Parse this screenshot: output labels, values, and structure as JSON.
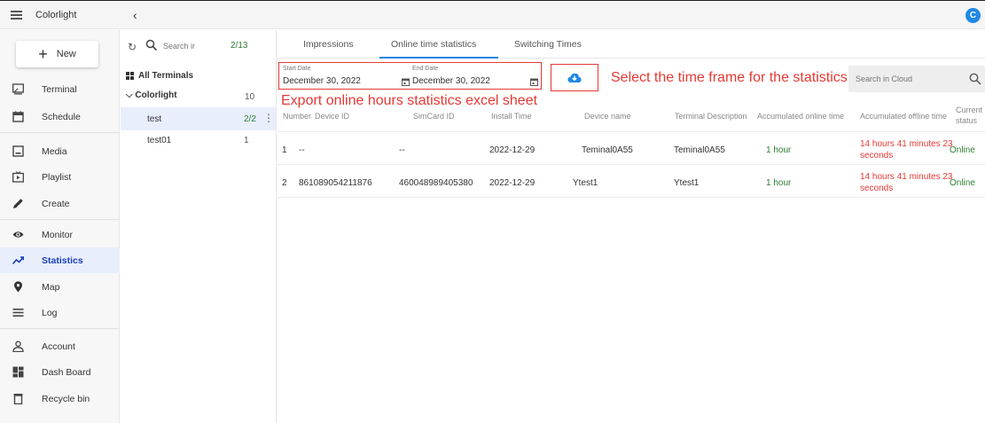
{
  "app": {
    "title": "Colorlight",
    "avatar_letter": "C",
    "collapse_glyph": "‹"
  },
  "nav": {
    "new_label": "New",
    "items": [
      {
        "label": "Terminal",
        "icon": "terminal-icon"
      },
      {
        "label": "Schedule",
        "icon": "schedule-icon"
      },
      {
        "label": "Media",
        "icon": "media-icon"
      },
      {
        "label": "Playlist",
        "icon": "playlist-icon"
      },
      {
        "label": "Create",
        "icon": "create-icon"
      },
      {
        "label": "Monitor",
        "icon": "eye-icon"
      },
      {
        "label": "Statistics",
        "icon": "statistics-icon",
        "active": true
      },
      {
        "label": "Map",
        "icon": "map-pin-icon"
      },
      {
        "label": "Log",
        "icon": "log-icon"
      },
      {
        "label": "Account",
        "icon": "account-icon"
      },
      {
        "label": "Dash Board",
        "icon": "dashboard-icon"
      },
      {
        "label": "Recycle bin",
        "icon": "recycle-bin-icon"
      }
    ]
  },
  "terminals": {
    "search_placeholder": "Search ir",
    "count": "2/13",
    "all_label": "All Terminals",
    "group": {
      "name": "Colorlight",
      "count": "10"
    },
    "rows": [
      {
        "name": "test",
        "count": "2/2"
      },
      {
        "name": "test01",
        "count": "1"
      }
    ]
  },
  "tabs": [
    "Impressions",
    "Online time statistics",
    "Switching Times"
  ],
  "filters": {
    "start_label": "Start Date",
    "start_value": "December 30, 2022",
    "end_label": "End Date",
    "end_value": "December 30, 2022",
    "cloud_search_placeholder": "Search in Cloud"
  },
  "annotations": {
    "time_frame": "Select the time frame for the statistics",
    "export": "Export online hours statistics excel sheet"
  },
  "table": {
    "headers": [
      "Number",
      "Device ID",
      "SimCard ID",
      "Install Time",
      "Device name",
      "Terminal Description",
      "Accumulated online time",
      "Accumulated offline time",
      "Current",
      "status"
    ],
    "rows": [
      {
        "number": "1",
        "device_id": "--",
        "simcard_id": "--",
        "install_time": "2022-12-29",
        "device_name": "Teminal0A55",
        "description": "Teminal0A55",
        "online_time": "1 hour",
        "offline_time_1": "14 hours 41 minutes 23",
        "offline_time_2": "seconds",
        "status": "Online"
      },
      {
        "number": "2",
        "device_id": "861089054211876",
        "simcard_id": "460048989405380",
        "install_time": "2022-12-29",
        "device_name": "Ytest1",
        "description": "Ytest1",
        "online_time": "1 hour",
        "offline_time_1": "14 hours 41 minutes 23",
        "offline_time_2": "seconds",
        "status": "Online"
      }
    ]
  },
  "colors": {
    "accent": "#1e88e5",
    "annotation": "#e53935",
    "online": "#2e7d32",
    "active_nav": "#1a3fb5"
  }
}
